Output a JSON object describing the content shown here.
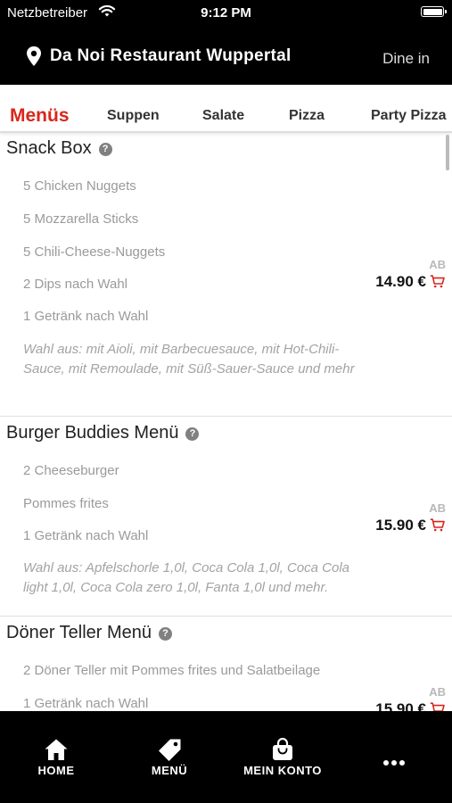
{
  "status": {
    "carrier": "Netzbetreiber",
    "time": "9:12 PM"
  },
  "header": {
    "restaurant": "Da Noi Restaurant Wuppertal",
    "mode": "Dine in"
  },
  "tabs": [
    "Menüs",
    "Suppen",
    "Salate",
    "Pizza",
    "Party Pizza"
  ],
  "items": [
    {
      "title": "Snack Box",
      "lines": [
        "5 Chicken Nuggets",
        "5 Mozzarella Sticks",
        "5 Chili-Cheese-Nuggets",
        "2 Dips nach Wahl",
        "1 Getränk nach Wahl"
      ],
      "note": "Wahl aus: mit Aioli, mit Barbecuesauce, mit Hot-Chili-Sauce, mit Remoulade, mit Süß-Sauer-Sauce und mehr",
      "price_prefix": "AB",
      "price": "14.90 €"
    },
    {
      "title": "Burger Buddies Menü",
      "lines": [
        "2 Cheeseburger",
        "Pommes frites",
        "1 Getränk nach Wahl"
      ],
      "note": "Wahl aus: Apfelschorle 1,0l, Coca Cola 1,0l, Coca Cola light 1,0l, Coca Cola zero 1,0l, Fanta 1,0l und mehr.",
      "price_prefix": "AB",
      "price": "15.90 €"
    },
    {
      "title": "Döner Teller Menü",
      "lines": [
        "2 Döner Teller mit Pommes frites und Salatbeilage",
        "1 Getränk nach Wahl"
      ],
      "price_prefix": "AB",
      "price": "15.90 €"
    }
  ],
  "help_glyph": "?",
  "bottom_nav": [
    {
      "label": "HOME",
      "icon": "home-icon"
    },
    {
      "label": "MENÜ",
      "icon": "tag-icon"
    },
    {
      "label": "MEIN KONTO",
      "icon": "shopping-bag-icon"
    },
    {
      "label": "",
      "icon": "more-dots-icon"
    }
  ],
  "colors": {
    "accent": "#d9261c",
    "bar": "#000000"
  }
}
